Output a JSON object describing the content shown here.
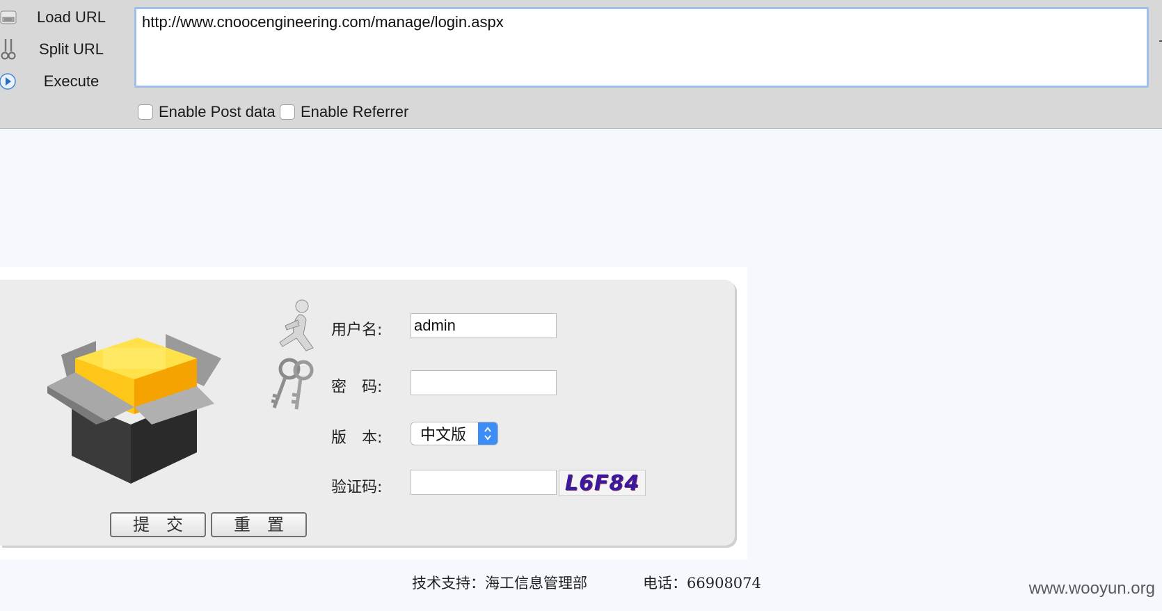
{
  "hackbar": {
    "buttons": [
      {
        "label": "Load URL",
        "icon": "load-url-icon"
      },
      {
        "label": "Split URL",
        "icon": "split-url-icon"
      },
      {
        "label": "Execute",
        "icon": "execute-icon"
      }
    ],
    "url": "http://www.cnoocengineering.com/manage/login.aspx",
    "enable_post_label": "Enable Post data",
    "enable_referrer_label": "Enable Referrer",
    "enable_post_checked": false,
    "enable_referrer_checked": false
  },
  "login": {
    "username_label": "用户名:",
    "username_value": "admin",
    "password_label": "密　码:",
    "password_value": "",
    "version_label": "版　本:",
    "version_selected": "中文版",
    "captcha_label": "验证码:",
    "captcha_value": "",
    "captcha_image_text": "L6F84",
    "submit_label": "提　交",
    "reset_label": "重　置"
  },
  "footer": {
    "support": "技术支持：海工信息管理部",
    "phone": "电话：66908074"
  },
  "watermark": "www.wooyun.org",
  "colors": {
    "toolbar_bg": "#d8d8d8",
    "url_border": "#9ec0e8",
    "page_bg": "#f5f9fe",
    "panel_bg": "#ececec",
    "select_accent": "#3a8ef5",
    "captcha_text": "#3a1a9a"
  }
}
